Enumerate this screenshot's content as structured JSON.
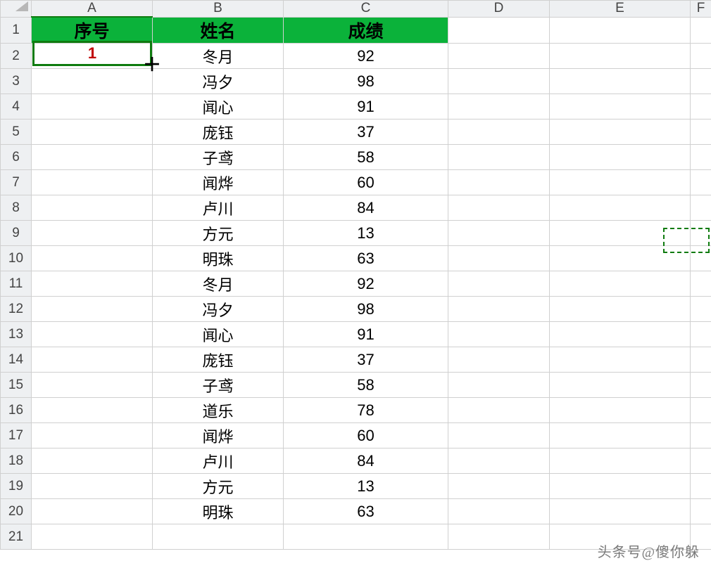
{
  "columns": [
    "A",
    "B",
    "C",
    "D",
    "E",
    "F"
  ],
  "column_active": "A",
  "row_count": 21,
  "headers": {
    "A": "序号",
    "B": "姓名",
    "C": "成绩"
  },
  "selected_cell": {
    "address": "A2",
    "value": "1",
    "color": "#c00000"
  },
  "rows": [
    {
      "r": 2,
      "A": "",
      "B": "冬月",
      "C": "92"
    },
    {
      "r": 3,
      "A": "",
      "B": "冯夕",
      "C": "98"
    },
    {
      "r": 4,
      "A": "",
      "B": "闻心",
      "C": "91"
    },
    {
      "r": 5,
      "A": "",
      "B": "庞钰",
      "C": "37"
    },
    {
      "r": 6,
      "A": "",
      "B": "子鸢",
      "C": "58"
    },
    {
      "r": 7,
      "A": "",
      "B": "闻烨",
      "C": "60"
    },
    {
      "r": 8,
      "A": "",
      "B": "卢川",
      "C": "84"
    },
    {
      "r": 9,
      "A": "",
      "B": "方元",
      "C": "13"
    },
    {
      "r": 10,
      "A": "",
      "B": "明珠",
      "C": "63"
    },
    {
      "r": 11,
      "A": "",
      "B": "冬月",
      "C": "92"
    },
    {
      "r": 12,
      "A": "",
      "B": "冯夕",
      "C": "98"
    },
    {
      "r": 13,
      "A": "",
      "B": "闻心",
      "C": "91"
    },
    {
      "r": 14,
      "A": "",
      "B": "庞钰",
      "C": "37"
    },
    {
      "r": 15,
      "A": "",
      "B": "子鸢",
      "C": "58"
    },
    {
      "r": 16,
      "A": "",
      "B": "道乐",
      "C": "78"
    },
    {
      "r": 17,
      "A": "",
      "B": "闻烨",
      "C": "60"
    },
    {
      "r": 18,
      "A": "",
      "B": "卢川",
      "C": "84"
    },
    {
      "r": 19,
      "A": "",
      "B": "方元",
      "C": "13"
    },
    {
      "r": 20,
      "A": "",
      "B": "明珠",
      "C": "63"
    },
    {
      "r": 21,
      "A": "",
      "B": "",
      "C": ""
    }
  ],
  "marquee": {
    "address": "F9"
  },
  "watermark": "头条号@傻你躲"
}
